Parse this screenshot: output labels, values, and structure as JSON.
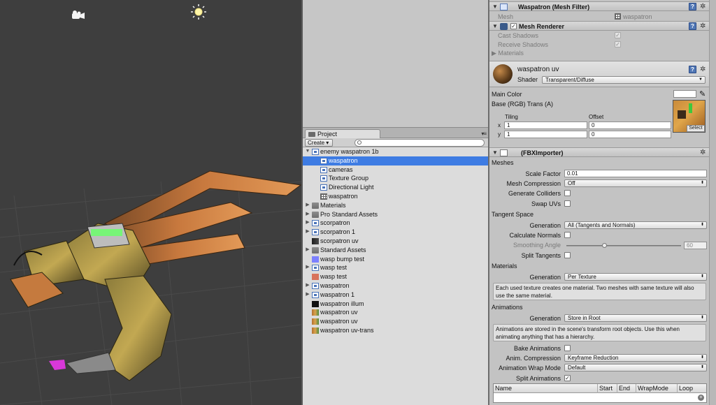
{
  "scene": {
    "icons": [
      "camera-gizmo-icon",
      "light-gizmo-icon"
    ]
  },
  "project": {
    "tab_label": "Project",
    "create_label": "Create",
    "search_placeholder": "",
    "tree": [
      {
        "label": "enemy waspatron 1b",
        "icon": "prefab",
        "depth": 0,
        "arrow": "down"
      },
      {
        "label": "waspatron",
        "icon": "prefab",
        "depth": 1,
        "arrow": "",
        "selected": true
      },
      {
        "label": "cameras",
        "icon": "prefab",
        "depth": 1,
        "arrow": ""
      },
      {
        "label": "Texture Group",
        "icon": "prefab",
        "depth": 1,
        "arrow": ""
      },
      {
        "label": "Directional Light",
        "icon": "prefab",
        "depth": 1,
        "arrow": ""
      },
      {
        "label": "waspatron",
        "icon": "mesh",
        "depth": 1,
        "arrow": ""
      },
      {
        "label": "Materials",
        "icon": "folder",
        "depth": 0,
        "arrow": "right"
      },
      {
        "label": "Pro Standard Assets",
        "icon": "folder",
        "depth": 0,
        "arrow": "right"
      },
      {
        "label": "scorpatron",
        "icon": "prefab",
        "depth": 0,
        "arrow": "right"
      },
      {
        "label": "scorpatron 1",
        "icon": "prefab",
        "depth": 0,
        "arrow": "right"
      },
      {
        "label": "scorpatron uv",
        "icon": "tex-dark2",
        "depth": 0,
        "arrow": ""
      },
      {
        "label": "Standard Assets",
        "icon": "folder",
        "depth": 0,
        "arrow": "right"
      },
      {
        "label": "wasp bump test",
        "icon": "swatch-blue",
        "depth": 0,
        "arrow": ""
      },
      {
        "label": "wasp test",
        "icon": "prefab",
        "depth": 0,
        "arrow": "right"
      },
      {
        "label": "wasp test",
        "icon": "swatch-red",
        "depth": 0,
        "arrow": ""
      },
      {
        "label": "waspatron",
        "icon": "prefab",
        "depth": 0,
        "arrow": "right"
      },
      {
        "label": "waspatron 1",
        "icon": "prefab",
        "depth": 0,
        "arrow": "right"
      },
      {
        "label": "waspatron illum",
        "icon": "tex-dark",
        "depth": 0,
        "arrow": ""
      },
      {
        "label": "waspatron uv",
        "icon": "tex-orange",
        "depth": 0,
        "arrow": ""
      },
      {
        "label": "waspatron uv",
        "icon": "tex-orange",
        "depth": 0,
        "arrow": ""
      },
      {
        "label": "waspatron uv-trans",
        "icon": "tex-orange",
        "depth": 0,
        "arrow": ""
      }
    ]
  },
  "inspector": {
    "mesh_filter": {
      "title": "Waspatron (Mesh Filter)",
      "mesh_label": "Mesh",
      "mesh_value": "waspatron"
    },
    "mesh_renderer": {
      "title": "Mesh Renderer",
      "cast_shadows_label": "Cast Shadows",
      "cast_shadows": "✓",
      "receive_shadows_label": "Receive Shadows",
      "receive_shadows": "✓",
      "materials_label": "Materials"
    },
    "material": {
      "name": "waspatron uv",
      "shader_label": "Shader",
      "shader_value": "Transparent/Diffuse",
      "main_color_label": "Main Color",
      "base_label": "Base (RGB) Trans (A)",
      "tiling_label": "Tiling",
      "offset_label": "Offset",
      "x_label": "x",
      "y_label": "y",
      "tiling_x": "1",
      "tiling_y": "1",
      "offset_x": "0",
      "offset_y": "0",
      "select_label": "Select"
    },
    "fbx": {
      "title": "(FBXImporter)",
      "meshes_section": "Meshes",
      "scale_factor_label": "Scale Factor",
      "scale_factor": "0.01",
      "mesh_compression_label": "Mesh Compression",
      "mesh_compression": "Off",
      "generate_colliders_label": "Generate Colliders",
      "swap_uvs_label": "Swap UVs",
      "tangent_section": "Tangent Space",
      "generation_label": "Generation",
      "tangent_generation": "All (Tangents and Normals)",
      "calculate_normals_label": "Calculate Normals",
      "smoothing_angle_label": "Smoothing Angle",
      "smoothing_angle": "60",
      "smoothing_fraction": 0.33,
      "split_tangents_label": "Split Tangents",
      "materials_section": "Materials",
      "materials_generation": "Per Texture",
      "materials_info": "Each used texture creates one material. Two meshes with same texture will also use the same material.",
      "animations_section": "Animations",
      "animations_generation": "Store in Root",
      "animations_info": "Animations are stored in the scene's transform root objects. Use this when animating anything that has a hierarchy.",
      "bake_animations_label": "Bake Animations",
      "anim_compression_label": "Anim. Compression",
      "anim_compression": "Keyframe Reduction",
      "wrap_mode_label": "Animation Wrap Mode",
      "wrap_mode": "Default",
      "split_animations_label": "Split Animations",
      "split_animations": "✓",
      "table_headers": [
        "Name",
        "Start",
        "End",
        "WrapMode",
        "Loop"
      ],
      "add_icon": "+"
    },
    "help_glyph": "?",
    "gear_glyph": "✲"
  }
}
